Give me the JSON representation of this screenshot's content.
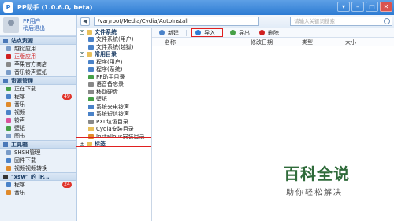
{
  "window": {
    "title": "PP助手 (1.0.6.0, beta)"
  },
  "user": {
    "name": "PP用户",
    "logout": "稍后退出"
  },
  "sidebar": {
    "sections": [
      {
        "title": "站点资源",
        "items": [
          {
            "label": "越狱应用",
            "color": "#7a9cc8"
          },
          {
            "label": "正版应用",
            "color": "#d02020",
            "red": true
          },
          {
            "label": "苹果官方商店",
            "color": "#888888"
          },
          {
            "label": "音乐铃声壁纸",
            "color": "#7a9cc8"
          }
        ]
      },
      {
        "title": "资源管理",
        "items": [
          {
            "label": "正在下载",
            "color": "#46a047"
          },
          {
            "label": "程序",
            "color": "#4a82c8",
            "badge": "49"
          },
          {
            "label": "音乐",
            "color": "#e08a2a"
          },
          {
            "label": "视频",
            "color": "#4a82c8"
          },
          {
            "label": "铃声",
            "color": "#d9539b"
          },
          {
            "label": "壁纸",
            "color": "#46a047"
          },
          {
            "label": "图书",
            "color": "#7a9cc8"
          }
        ]
      },
      {
        "title": "工具箱",
        "items": [
          {
            "label": "SHSH管理",
            "color": "#7a9cc8"
          },
          {
            "label": "固件下载",
            "color": "#4a82c8"
          },
          {
            "label": "视频视频转换",
            "color": "#e08a2a"
          }
        ]
      },
      {
        "title": "\"xsw\" 的 iP...",
        "dark": true,
        "items": [
          {
            "label": "程序",
            "color": "#4a82c8",
            "badge": "24"
          },
          {
            "label": "音乐",
            "color": "#e08a2a"
          }
        ]
      }
    ]
  },
  "address": {
    "path": "/var/root/Media/Cydia/AutoInstall",
    "search_placeholder": "请输入关键词搜索"
  },
  "tree": {
    "nodes": [
      {
        "label": "文件系统",
        "level": 0,
        "toggle": "-"
      },
      {
        "label": "文件系统(用户)",
        "level": 1,
        "color": "#4a82c8"
      },
      {
        "label": "文件系统(越狱)",
        "level": 1,
        "color": "#4a82c8"
      },
      {
        "label": "常用目录",
        "level": 0,
        "toggle": "-"
      },
      {
        "label": "程序(用户)",
        "level": 1,
        "color": "#4a82c8"
      },
      {
        "label": "程序(系统)",
        "level": 1,
        "color": "#4a82c8"
      },
      {
        "label": "PP助手目录",
        "level": 1,
        "color": "#46a047"
      },
      {
        "label": "语音备忘录",
        "level": 1,
        "color": "#888888"
      },
      {
        "label": "移动硬盘",
        "level": 1,
        "color": "#888888"
      },
      {
        "label": "壁纸",
        "level": 1,
        "color": "#46a047"
      },
      {
        "label": "系统来电铃声",
        "level": 1,
        "color": "#4a82c8"
      },
      {
        "label": "系统短信铃声",
        "level": 1,
        "color": "#4a82c8"
      },
      {
        "label": "PXL垃圾目录",
        "level": 1,
        "color": "#888888"
      },
      {
        "label": "Cydia安装目录",
        "level": 1,
        "color": "#e8c05a"
      },
      {
        "label": "Installous安装目录",
        "level": 1,
        "color": "#e08a2a"
      },
      {
        "label": "标签",
        "level": 0,
        "toggle": "+"
      }
    ]
  },
  "toolbar": {
    "new": "新建",
    "import": "导入",
    "export": "导出",
    "delete": "删除"
  },
  "table": {
    "columns": [
      "名称",
      "修改日期",
      "类型",
      "大小"
    ]
  },
  "watermark": {
    "title": "百科全说",
    "subtitle": "助你轻松解决"
  }
}
